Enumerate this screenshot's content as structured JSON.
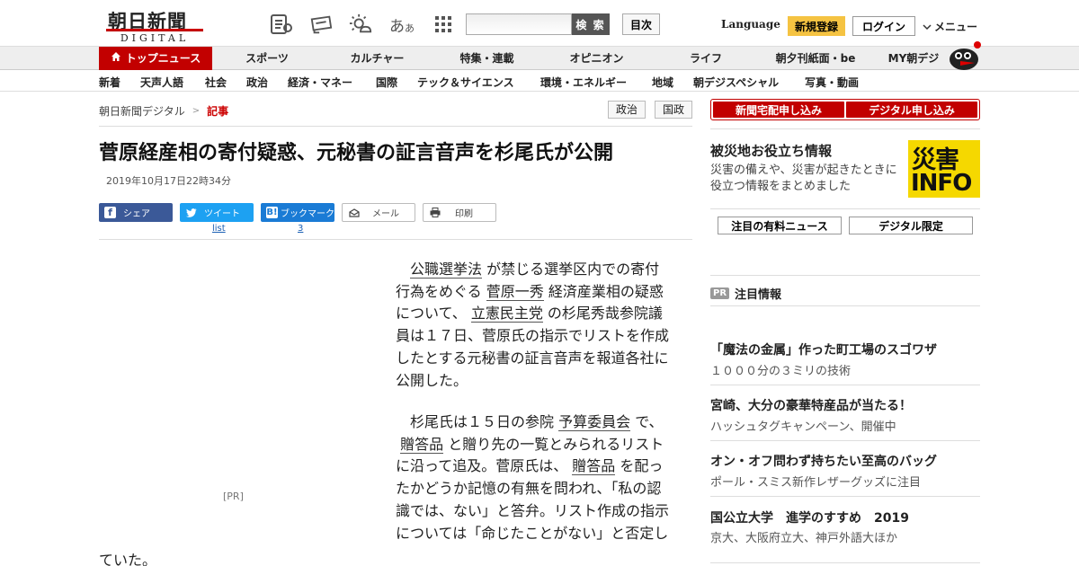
{
  "header": {
    "logo_ja": "朝日新聞",
    "logo_en": "DIGITAL",
    "font_size_glyph": "あ",
    "font_size_glyph_small": "あ",
    "search_placeholder": "",
    "search_label": "検 索",
    "toc_label": "目次",
    "language_label": "Language",
    "register_label": "新規登録",
    "login_label": "ログイン",
    "menu_label": "メニュー"
  },
  "nav_main": {
    "top_news": "トップニュース",
    "items": [
      "スポーツ",
      "カルチャー",
      "特集・連載",
      "オピニオン",
      "ライフ",
      "朝夕刊紙面・be",
      "MY朝デジ"
    ]
  },
  "nav_sub": {
    "items": [
      "新着",
      "天声人語",
      "社会",
      "政治",
      "経済・マネー",
      "国際",
      "テック＆サイエンス",
      "環境・エネルギー",
      "地域",
      "朝デジスペシャル",
      "写真・動画"
    ]
  },
  "breadcrumb": {
    "home": "朝日新聞デジタル",
    "separator": ">",
    "current": "記事"
  },
  "tags": [
    "政治",
    "国政"
  ],
  "article": {
    "title": "菅原経産相の寄付疑惑、元秘書の証言音声を杉尾氏が公開",
    "date": "2019年10月17日22時34分",
    "share": {
      "facebook": "シェア",
      "twitter": "ツイート",
      "twitter_count": "list",
      "hatena": "ブックマーク",
      "hatena_count": "3",
      "mail": "メール",
      "print": "印刷"
    },
    "ad_label": "[PR]",
    "p1": {
      "l1a": "公職選挙法",
      "l1b": " が禁じる選挙区内での寄付",
      "l2a": "行為をめぐる ",
      "l2b": "菅原一秀",
      "l2c": " 経済産業相の疑惑",
      "l3a": "について、 ",
      "l3b": "立憲民主党",
      "l3c": " の杉尾秀哉参院議",
      "l4": "員は１７日、菅原氏の指示でリストを作成",
      "l5": "したとする元秘書の証言音声を報道各社に",
      "l6": "公開した。"
    },
    "p2": {
      "l1a": "杉尾氏は１５日の参院 ",
      "l1b": "予算委員会",
      "l1c": " で、",
      "l2a": "贈答品",
      "l2b": " と贈り先の一覧とみられるリスト",
      "l3a": "に沿って追及。菅原氏は、 ",
      "l3b": "贈答品",
      "l3c": " を配っ",
      "l4": "たかどうか記憶の有無を問われ、「私の認",
      "l5": "識では、ない」と答弁。リスト作成の指示",
      "l6": "については「命じたことがない」と否定し",
      "l7": "ていた。"
    }
  },
  "sidebar": {
    "subscribe_paper": "新聞宅配申し込み",
    "subscribe_digital": "デジタル申し込み",
    "disaster_title": "被災地お役立ち情報",
    "disaster_desc": "災害の備えや、災害が起きたときに役立つ情報をまとめました",
    "disaster_logo_kanji": "災害",
    "disaster_logo_info": "INFO",
    "paid_news": "注目の有料ニュース",
    "digital_only": "デジタル限定",
    "pr_badge": "PR",
    "pr_title": "注目情報",
    "promos": [
      {
        "title": "「魔法の金属」作った町工場のスゴワザ",
        "sub": "１０００分の３ミリの技術"
      },
      {
        "title": "宮崎、大分の豪華特産品が当たる！",
        "sub": "ハッシュタグキャンペーン、開催中"
      },
      {
        "title": "オン・オフ問わず持ちたい至高のバッグ",
        "sub": "ポール・スミス新作レザーグッズに注目"
      },
      {
        "title": "国公立大学　進学のすすめ　2019",
        "sub": "京大、大阪府立大、神戸外語大ほか"
      }
    ]
  },
  "colors": {
    "brand_red": "#c20000",
    "register_yellow": "#f5c342",
    "facebook": "#3b5998",
    "twitter": "#1da1f2",
    "hatena": "#1a7bd5",
    "disaster_yellow": "#f5d800"
  }
}
